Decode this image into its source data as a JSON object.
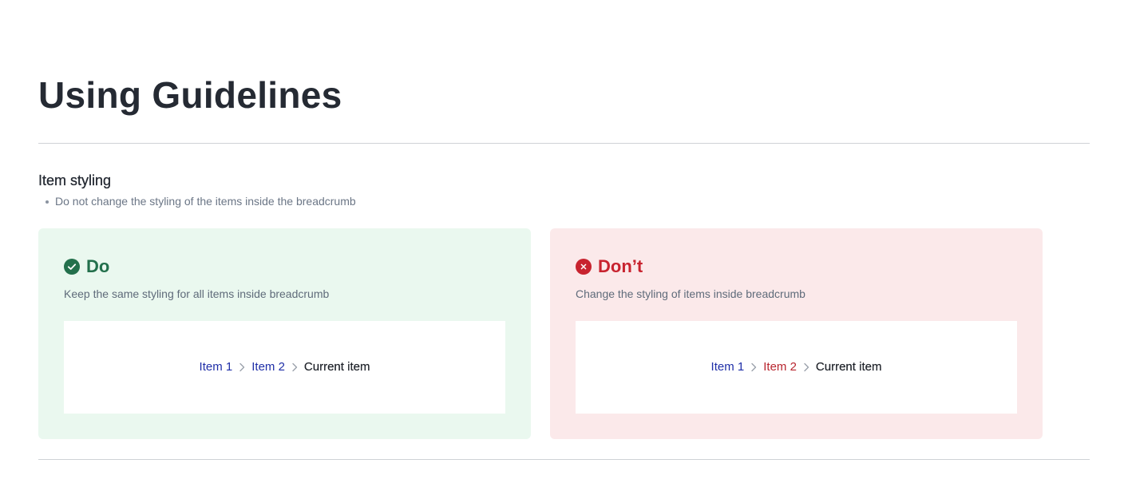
{
  "page": {
    "title": "Using Guidelines"
  },
  "section": {
    "title": "Item styling",
    "bullets": [
      "Do not change the styling of the items inside the breadcrumb"
    ]
  },
  "do_card": {
    "icon": "check-circle-icon",
    "title": "Do",
    "description": "Keep the same styling for all items inside breadcrumb",
    "breadcrumb": {
      "items": [
        "Item 1",
        "Item 2"
      ],
      "current": "Current item"
    }
  },
  "dont_card": {
    "icon": "x-circle-icon",
    "title": "Don’t",
    "description": "Change the styling of items inside breadcrumb",
    "breadcrumb": {
      "items": [
        "Item 1",
        "Item 2"
      ],
      "current": "Current item"
    }
  },
  "colors": {
    "do_background": "#eaf8ef",
    "do_accent": "#23704c",
    "dont_background": "#fbe9ea",
    "dont_accent": "#c8232f",
    "link": "#1f2fa8",
    "altered_link": "#b8262f"
  }
}
